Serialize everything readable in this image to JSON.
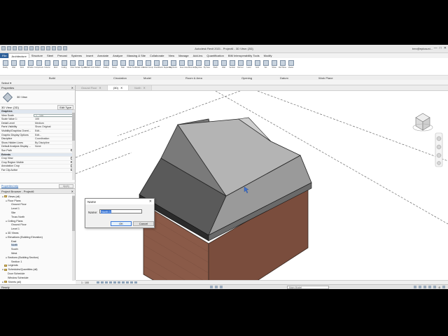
{
  "window": {
    "title": "Autodesk Revit 2021 - Project6 - 3D View: {3D}",
    "user": "trev@eplusuni...",
    "controls": [
      "—",
      "□",
      "✕"
    ]
  },
  "ribbon": {
    "tabs": [
      "File",
      "Architecture",
      "Structure",
      "Steel",
      "Precast",
      "Systems",
      "Insert",
      "Annotate",
      "Analyze",
      "Massing & Site",
      "Collaborate",
      "View",
      "Manage",
      "Add-Ins",
      "Quantification",
      "BIM Interoperability Tools",
      "Modify"
    ],
    "active_tab": "Architecture",
    "tools": [
      "Modify",
      "Wall",
      "Door",
      "Window",
      "Component",
      "Column",
      "Roof",
      "Ceiling",
      "Floor",
      "Curtain System",
      "Curtain Grid",
      "Mullion",
      "Railing",
      "Ramp",
      "Stair",
      "Model Text",
      "Model Line",
      "Model Group",
      "Room",
      "Room Separator",
      "Tag Room",
      "Area",
      "Area Boundary",
      "Tag Area",
      "By Face",
      "Shaft",
      "Wall",
      "Vertical",
      "Dormer",
      "Level",
      "Grid",
      "Set",
      "Show",
      "Ref Plane",
      "Viewer"
    ],
    "panels": [
      "Build",
      "Circulation",
      "Model",
      "Room & Area",
      "Opening",
      "Datum",
      "Work Plane"
    ]
  },
  "select_label": "Select ▾",
  "properties": {
    "title": "Properties",
    "type_name": "3D View",
    "selector": "3D View: {3D}",
    "edit_type": "Edit Type",
    "rows": [
      {
        "k": "Graphics",
        "v": "",
        "group": true
      },
      {
        "k": "View Scale",
        "v": "1 : 100"
      },
      {
        "k": "Scale Value 1:",
        "v": "100"
      },
      {
        "k": "Detail Level",
        "v": "Medium"
      },
      {
        "k": "Parts Visibility",
        "v": "Show Original"
      },
      {
        "k": "Visibility/Graphics Overri...",
        "v": "Edit..."
      },
      {
        "k": "Graphic Display Options",
        "v": "Edit..."
      },
      {
        "k": "Discipline",
        "v": "Coordination"
      },
      {
        "k": "Show Hidden Lines",
        "v": "By Discipline"
      },
      {
        "k": "Default Analysis Display ...",
        "v": "None"
      },
      {
        "k": "Sun Path",
        "v": "",
        "chk": true
      },
      {
        "k": "Extents",
        "v": "",
        "group": true
      },
      {
        "k": "Crop View",
        "v": "",
        "chk": true
      },
      {
        "k": "Crop Region Visible",
        "v": "",
        "chk": true
      },
      {
        "k": "Annotation Crop",
        "v": "",
        "chk": true
      },
      {
        "k": "Far Clip Active",
        "v": "",
        "chk": true
      }
    ],
    "help": "Properties help",
    "apply": "Apply"
  },
  "browser": {
    "title": "Project Browser - Project6",
    "nodes": [
      {
        "label": "Views (all)",
        "depth": 0,
        "tw": "⊟",
        "folder": true
      },
      {
        "label": "Floor Plans",
        "depth": 1,
        "tw": "⊟"
      },
      {
        "label": "Ground Floor",
        "depth": 2,
        "tw": ""
      },
      {
        "label": "Level 1",
        "depth": 2,
        "tw": ""
      },
      {
        "label": "Site",
        "depth": 2,
        "tw": ""
      },
      {
        "label": "Truss North",
        "depth": 2,
        "tw": ""
      },
      {
        "label": "Ceiling Plans",
        "depth": 1,
        "tw": "⊟"
      },
      {
        "label": "Ground Floor",
        "depth": 2,
        "tw": ""
      },
      {
        "label": "Level 1",
        "depth": 2,
        "tw": ""
      },
      {
        "label": "3D Views",
        "depth": 1,
        "tw": "⊞"
      },
      {
        "label": "Elevations (Building Elevation)",
        "depth": 1,
        "tw": "⊟"
      },
      {
        "label": "East",
        "depth": 2,
        "tw": ""
      },
      {
        "label": "North",
        "depth": 2,
        "tw": "",
        "sel": true
      },
      {
        "label": "South",
        "depth": 2,
        "tw": ""
      },
      {
        "label": "West",
        "depth": 2,
        "tw": ""
      },
      {
        "label": "Sections (Building Section)",
        "depth": 1,
        "tw": "⊟"
      },
      {
        "label": "Section 1",
        "depth": 2,
        "tw": ""
      },
      {
        "label": "Legends",
        "depth": 0,
        "tw": "",
        "folder": true
      },
      {
        "label": "Schedules/Quantities (all)",
        "depth": 0,
        "tw": "⊟",
        "folder": true
      },
      {
        "label": "Door Schedule",
        "depth": 1,
        "tw": ""
      },
      {
        "label": "Window Schedule",
        "depth": 1,
        "tw": ""
      },
      {
        "label": "Sheets (all)",
        "depth": 0,
        "tw": "⊞",
        "folder": true
      }
    ]
  },
  "view_tabs": [
    {
      "label": "Ground Floor",
      "active": false
    },
    {
      "label": "{3D}",
      "active": true
    },
    {
      "label": "North",
      "active": false
    }
  ],
  "view_bar": {
    "scale": "1 : 100"
  },
  "dialog": {
    "title": "Name",
    "close": "✕",
    "name_label": "Name:",
    "name_value": "North 1",
    "ok": "OK",
    "cancel": "Cancel"
  },
  "status": {
    "ready": "Ready",
    "model": "Main Model",
    "filter": ":0"
  }
}
